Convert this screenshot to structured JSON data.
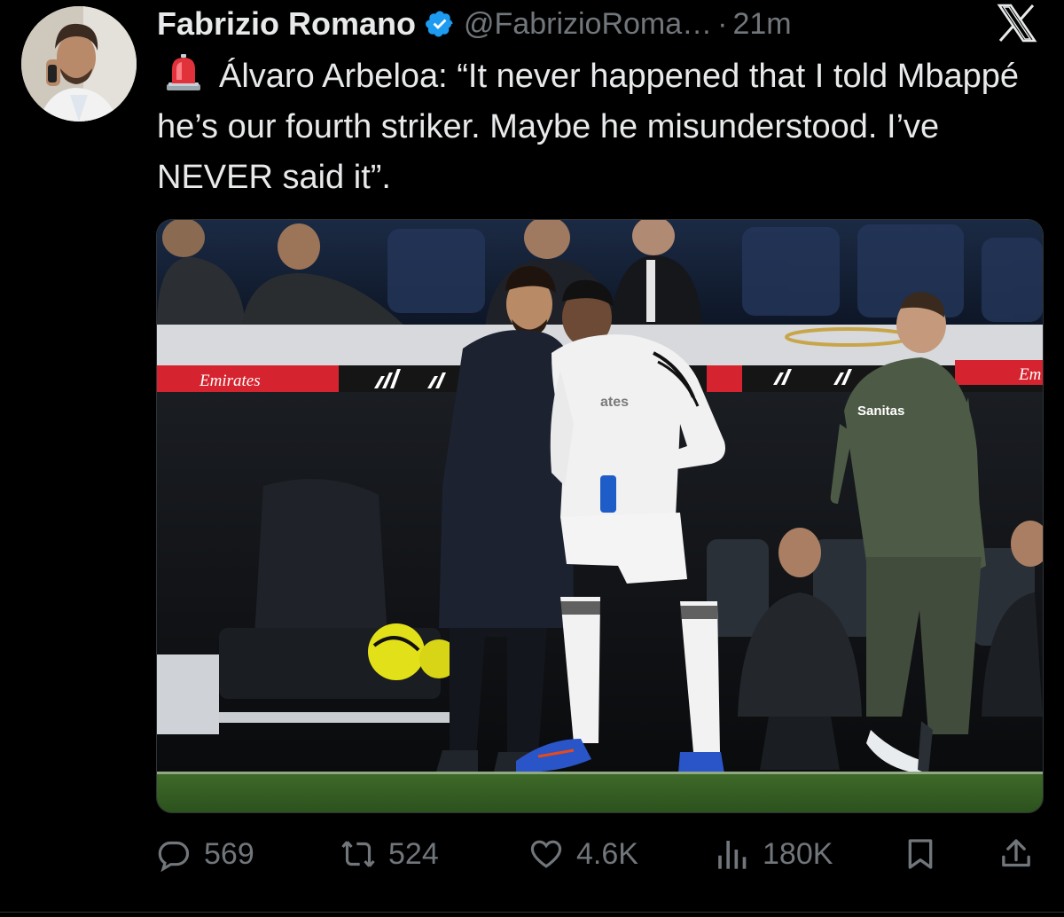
{
  "tweet": {
    "author": {
      "name": "Fabrizio Romano",
      "handle": "@FabrizioRoma…",
      "verified": true,
      "avatar_icon": "avatar"
    },
    "separator": "·",
    "time": "21m",
    "emoji_icon": "rotating-light-icon",
    "text": "Álvaro Arbeloa: “It never happened that I told Mbappé he’s our fourth striker. Maybe he misunderstood. I’ve NEVER said it”.",
    "media": {
      "board_left": "Emirates",
      "board_right": "Em",
      "sponsor": "Sanitas",
      "jersey_text": "ates"
    },
    "stats": {
      "replies": "569",
      "reposts": "524",
      "likes": "4.6K",
      "views": "180K"
    }
  },
  "colors": {
    "background": "#000000",
    "text": "#e7e9ea",
    "secondary": "#71767b",
    "verified": "#1d9bf0"
  }
}
